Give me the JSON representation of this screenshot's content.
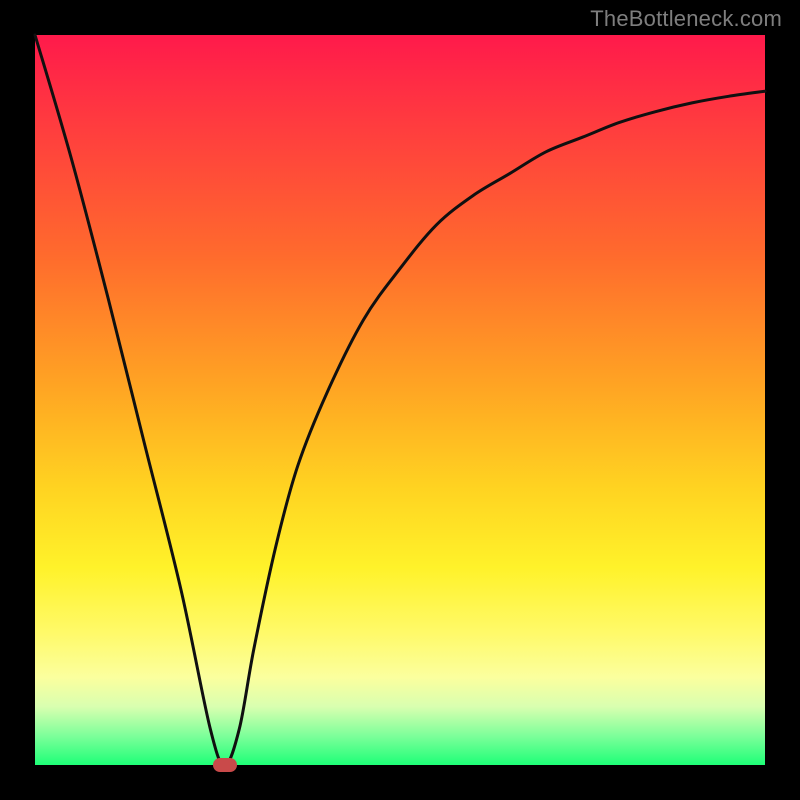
{
  "watermark": "TheBottleneck.com",
  "chart_data": {
    "type": "line",
    "title": "",
    "xlabel": "",
    "ylabel": "",
    "xlim": [
      0,
      100
    ],
    "ylim": [
      0,
      100
    ],
    "grid": false,
    "series": [
      {
        "name": "bottleneck-curve",
        "x": [
          0,
          5,
          10,
          15,
          20,
          24,
          26,
          28,
          30,
          33,
          36,
          40,
          45,
          50,
          55,
          60,
          65,
          70,
          75,
          80,
          85,
          90,
          95,
          100
        ],
        "values": [
          100,
          83,
          64,
          44,
          24,
          5,
          0,
          5,
          16,
          30,
          41,
          51,
          61,
          68,
          74,
          78,
          81,
          84,
          86,
          88,
          89.5,
          90.7,
          91.6,
          92.3
        ]
      }
    ],
    "marker": {
      "x": 26,
      "y": 0,
      "color": "#c94a4a"
    },
    "background_gradient": {
      "top": "#ff1a4b",
      "mid_upper": "#ffa423",
      "mid_lower": "#fff22a",
      "bottom": "#1eff77"
    }
  }
}
